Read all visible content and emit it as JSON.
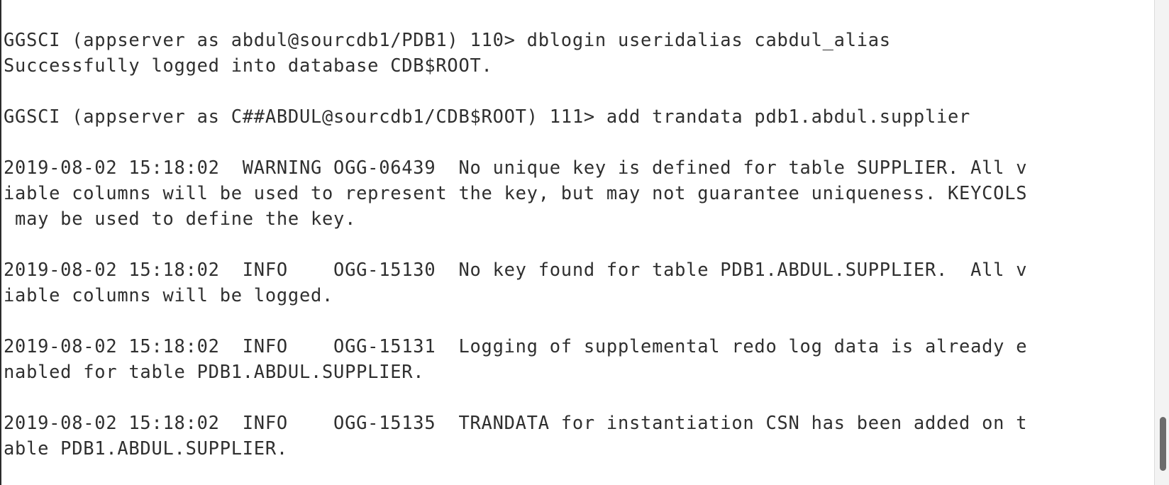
{
  "terminal": {
    "lines": [
      "GGSCI (appserver as abdul@sourcdb1/PDB1) 110> dblogin useridalias cabdul_alias",
      "Successfully logged into database CDB$ROOT.",
      "",
      "GGSCI (appserver as C##ABDUL@sourcdb1/CDB$ROOT) 111> add trandata pdb1.abdul.supplier",
      "",
      "2019-08-02 15:18:02  WARNING OGG-06439  No unique key is defined for table SUPPLIER. All v",
      "iable columns will be used to represent the key, but may not guarantee uniqueness. KEYCOLS",
      " may be used to define the key.",
      "",
      "2019-08-02 15:18:02  INFO    OGG-15130  No key found for table PDB1.ABDUL.SUPPLIER.  All v",
      "iable columns will be logged.",
      "",
      "2019-08-02 15:18:02  INFO    OGG-15131  Logging of supplemental redo log data is already e",
      "nabled for table PDB1.ABDUL.SUPPLIER.",
      "",
      "2019-08-02 15:18:02  INFO    OGG-15135  TRANDATA for instantiation CSN has been added on t",
      "able PDB1.ABDUL.SUPPLIER.",
      ""
    ]
  }
}
